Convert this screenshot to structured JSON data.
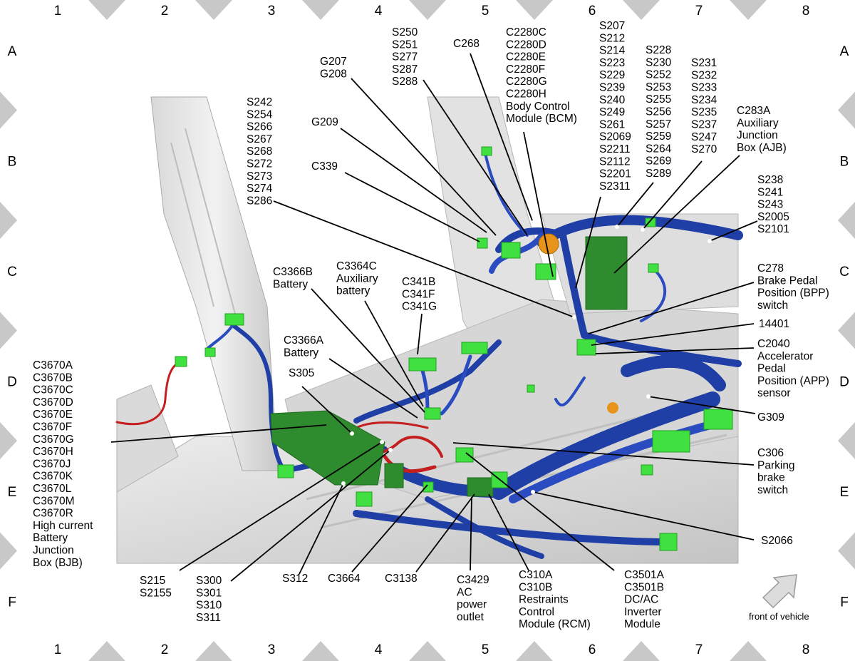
{
  "grid": {
    "columns": [
      "1",
      "2",
      "3",
      "4",
      "5",
      "6",
      "7",
      "8"
    ],
    "rows": [
      "A",
      "B",
      "C",
      "D",
      "E",
      "F"
    ]
  },
  "colors": {
    "harness_blue": "#1f3fa6",
    "power_red": "#c41e1e",
    "connector_green": "#3fe03f",
    "module_green": "#2e8b2e",
    "body_gray": "#d4d4d4",
    "marker_gray": "#c8c8c8"
  },
  "callouts": {
    "s242_group": [
      "S242",
      "S254",
      "S266",
      "S267",
      "S268",
      "S272",
      "S273",
      "S274",
      "S286"
    ],
    "g207_group": [
      "G207",
      "G208"
    ],
    "g209": [
      "G209"
    ],
    "c339": [
      "C339"
    ],
    "s250_group": [
      "S250",
      "S251",
      "S277",
      "S287",
      "S288"
    ],
    "c268": [
      "C268"
    ],
    "bcm_group": [
      "C2280C",
      "C2280D",
      "C2280E",
      "C2280F",
      "C2280G",
      "C2280H",
      "Body Control",
      "Module (BCM)"
    ],
    "s207_group": [
      "S207",
      "S212",
      "S214",
      "S223",
      "S229",
      "S239",
      "S240",
      "S249",
      "S261",
      "S2069",
      "S2211",
      "S2112",
      "S2201",
      "S2311"
    ],
    "s228_group": [
      "S228",
      "S230",
      "S252",
      "S253",
      "S255",
      "S256",
      "S257",
      "S259",
      "S264",
      "S269",
      "S289"
    ],
    "s231_group": [
      "S231",
      "S232",
      "S233",
      "S234",
      "S235",
      "S237",
      "S247",
      "S270"
    ],
    "ajb_group": [
      "C283A",
      "Auxiliary",
      "Junction",
      "Box (AJB)"
    ],
    "s238_group": [
      "S238",
      "S241",
      "S243",
      "S2005",
      "S2101"
    ],
    "bpp_group": [
      "C278",
      "Brake Pedal",
      "Position (BPP)",
      "switch"
    ],
    "n14401": [
      "14401"
    ],
    "app_group": [
      "C2040",
      "Accelerator",
      "Pedal",
      "Position (APP)",
      "sensor"
    ],
    "g309": [
      "G309"
    ],
    "c306_group": [
      "C306",
      "Parking",
      "brake",
      "switch"
    ],
    "s2066": [
      "S2066"
    ],
    "c3366b_group": [
      "C3366B",
      "Battery"
    ],
    "c3364c_group": [
      "C3364C",
      "Auxiliary",
      "battery"
    ],
    "c341_group": [
      "C341B",
      "C341F",
      "C341G"
    ],
    "c3366a_group": [
      "C3366A",
      "Battery"
    ],
    "s305": [
      "S305"
    ],
    "bjb_group": [
      "C3670A",
      "C3670B",
      "C3670C",
      "C3670D",
      "C3670E",
      "C3670F",
      "C3670G",
      "C3670H",
      "C3670J",
      "C3670K",
      "C3670L",
      "C3670M",
      "C3670R",
      "High current",
      "Battery",
      "Junction",
      "Box (BJB)"
    ],
    "s215_group": [
      "S215",
      "S2155"
    ],
    "s300_group": [
      "S300",
      "S301",
      "S310",
      "S311"
    ],
    "s312": [
      "S312"
    ],
    "c3664": [
      "C3664"
    ],
    "c3138": [
      "C3138"
    ],
    "c3429_group": [
      "C3429",
      "AC",
      "power",
      "outlet"
    ],
    "rcm_group": [
      "C310A",
      "C310B",
      "Restraints",
      "Control",
      "Module (RCM)"
    ],
    "inverter_group": [
      "C3501A",
      "C3501B",
      "DC/AC",
      "Inverter",
      "Module"
    ]
  },
  "front_label": "front of vehicle",
  "front_arrow_icon": "front-direction-arrow-icon"
}
